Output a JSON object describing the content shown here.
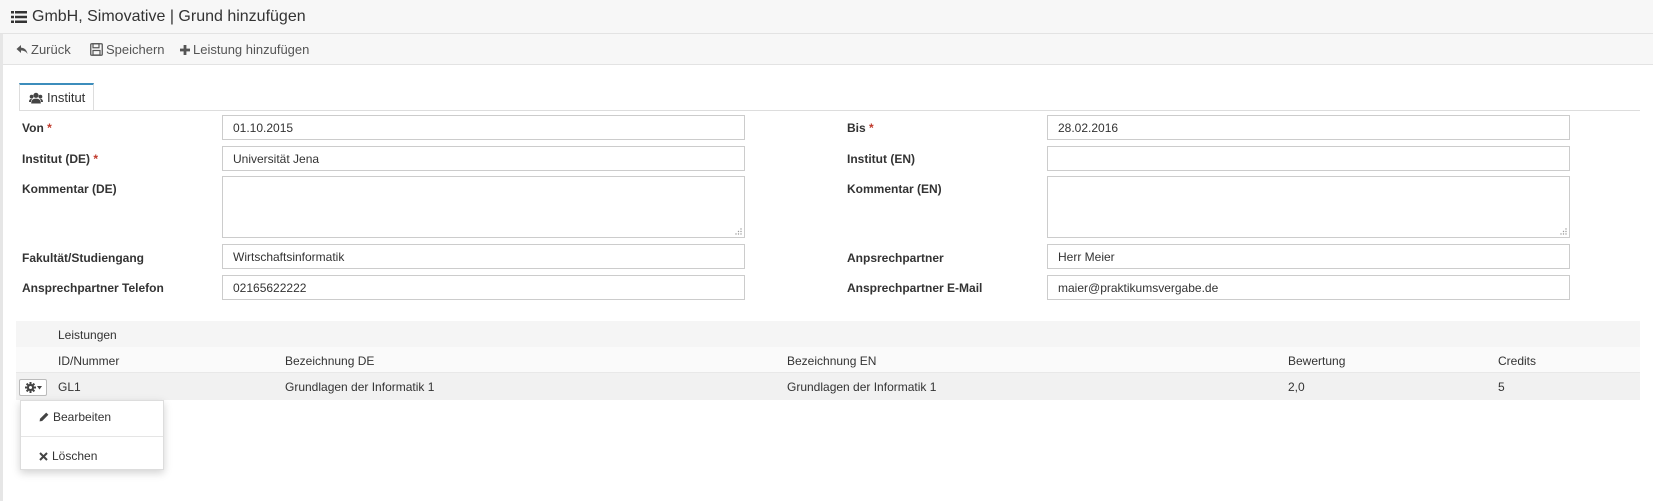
{
  "window": {
    "title": "GmbH, Simovative | Grund hinzufügen",
    "title_icon": "list-icon"
  },
  "toolbar": {
    "back_label": "Zurück",
    "back_icon": "reply-icon",
    "save_label": "Speichern",
    "save_icon": "floppy-icon",
    "add_label": "Leistung hinzufügen",
    "add_icon": "plus-icon"
  },
  "tab": {
    "label": "Institut",
    "icon": "users-icon",
    "accent": "#3c8dbc"
  },
  "form": {
    "required_marker": "*",
    "required_color": "#c0392b",
    "von": {
      "label": "Von",
      "value": "01.10.2015"
    },
    "bis": {
      "label": "Bis",
      "value": "28.02.2016"
    },
    "institut_de": {
      "label": "Institut (DE)",
      "value": "Universität Jena"
    },
    "institut_en": {
      "label": "Institut (EN)",
      "value": ""
    },
    "kommentar_de": {
      "label": "Kommentar (DE)",
      "value": ""
    },
    "kommentar_en": {
      "label": "Kommentar (EN)",
      "value": ""
    },
    "fakultaet": {
      "label": "Fakultät/Studiengang",
      "value": "Wirtschaftsinformatik"
    },
    "ansprechpartner": {
      "label": "Anpsrechpartner",
      "value": "Herr Meier"
    },
    "telefon": {
      "label": "Ansprechpartner Telefon",
      "value": "02165622222"
    },
    "email": {
      "label": "Ansprechpartner E-Mail",
      "value": "maier@praktikumsvergabe.de"
    }
  },
  "leistungen": {
    "title": "Leistungen",
    "columns": [
      "ID/Nummer",
      "Bezeichnung DE",
      "Bezeichnung EN",
      "Bewertung",
      "Credits"
    ],
    "rows": [
      {
        "id": "GL1",
        "bez_de": "Grundlagen der Informatik 1",
        "bez_en": "Grundlagen der Informatik 1",
        "bewertung": "2,0",
        "credits": "5"
      }
    ]
  },
  "row_menu": {
    "icon": "gear-icon",
    "edit_label": "Bearbeiten",
    "edit_icon": "pencil-icon",
    "delete_label": "Löschen",
    "delete_icon": "times-icon"
  }
}
